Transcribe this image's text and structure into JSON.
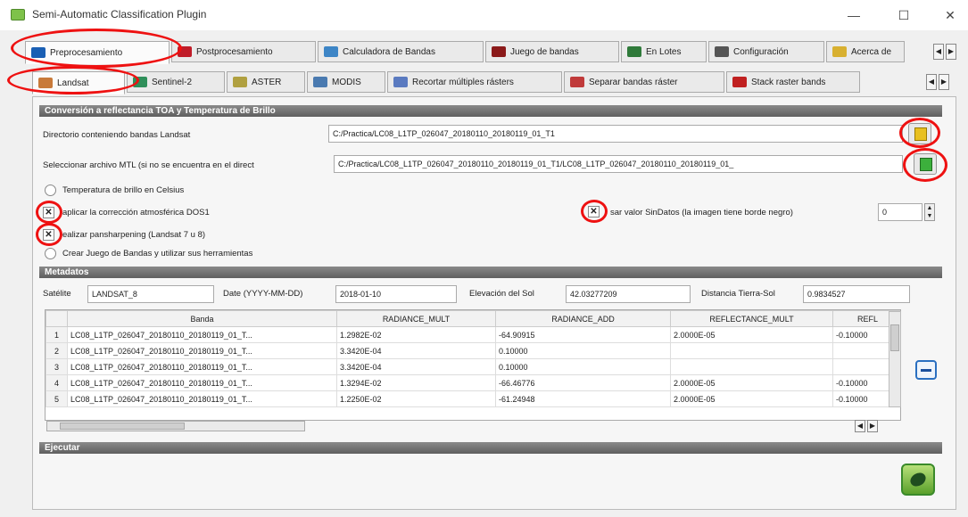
{
  "window": {
    "title": "Semi-Automatic Classification Plugin",
    "minimize": "—",
    "maximize": "☐",
    "close": "✕"
  },
  "main_tabs": [
    {
      "label": "Preprocesamiento",
      "icon": "arrow-in-icon",
      "color": "#1a5fb4"
    },
    {
      "label": "Postprocesamiento",
      "icon": "arrow-out-icon",
      "color": "#c01c28"
    },
    {
      "label": "Calculadora de Bandas",
      "icon": "calculator-icon",
      "color": "#3d85c6"
    },
    {
      "label": "Juego de bandas",
      "icon": "layers-icon",
      "color": "#8b1a1a"
    },
    {
      "label": "En Lotes",
      "icon": "batch-icon",
      "color": "#2f7a3a"
    },
    {
      "label": "Configuración",
      "icon": "tools-icon",
      "color": "#555555"
    },
    {
      "label": "Acerca de",
      "icon": "about-icon",
      "color": "#d8b030"
    }
  ],
  "sub_tabs": [
    {
      "label": "Landsat",
      "icon": "landsat-icon",
      "color": "#c87a3a"
    },
    {
      "label": "Sentinel-2",
      "icon": "sentinel-icon",
      "color": "#2f8f5a"
    },
    {
      "label": "ASTER",
      "icon": "aster-icon",
      "color": "#b0a040"
    },
    {
      "label": "MODIS",
      "icon": "modis-icon",
      "color": "#4a7ab0"
    },
    {
      "label": "Recortar múltiples rásters",
      "icon": "clip-icon",
      "color": "#5a7ac0"
    },
    {
      "label": "Separar bandas ráster",
      "icon": "split-icon",
      "color": "#c03a3a"
    },
    {
      "label": "Stack raster bands",
      "icon": "stack-icon",
      "color": "#c02020"
    }
  ],
  "conversion": {
    "header": "Conversión a reflectancia TOA y Temperatura de Brillo",
    "dir_label": "Directorio conteniendo bandas Landsat",
    "dir_value": "C:/Practica/LC08_L1TP_026047_20180110_20180119_01_T1",
    "mtl_label": "Seleccionar archivo MTL (si no se encuentra en el direct",
    "mtl_value": "C:/Practica/LC08_L1TP_026047_20180110_20180119_01_T1/LC08_L1TP_026047_20180110_20180119_01_",
    "celsius_label": "Temperatura de brillo en Celsius",
    "dos1_label": "aplicar la corrección atmosférica DOS1",
    "nodata_label": "sar valor SinDatos (la imagen tiene borde negro)",
    "nodata_value": "0",
    "pansharp_label": "ealizar pansharpening (Landsat 7 u 8)",
    "bandset_label": "Crear Juego de Bandas y utilizar sus herramientas",
    "checked_mark": "✕"
  },
  "metadata": {
    "header": "Metadatos",
    "satellite_label": "Satélite",
    "satellite_value": "LANDSAT_8",
    "date_label": "Date (YYYY-MM-DD)",
    "date_value": "2018-01-10",
    "sun_label": "Elevación del Sol",
    "sun_value": "42.03277209",
    "dist_label": "Distancia Tierra-Sol",
    "dist_value": "0.9834527"
  },
  "table": {
    "columns": [
      "Banda",
      "RADIANCE_MULT",
      "RADIANCE_ADD",
      "REFLECTANCE_MULT",
      "REFL"
    ],
    "rows": [
      {
        "n": "1",
        "banda": "LC08_L1TP_026047_20180110_20180119_01_T...",
        "rmult": "1.2982E-02",
        "radd": "-64.90915",
        "refmult": "2.0000E-05",
        "refl": "-0.10000"
      },
      {
        "n": "2",
        "banda": "LC08_L1TP_026047_20180110_20180119_01_T...",
        "rmult": "3.3420E-04",
        "radd": "0.10000",
        "refmult": "",
        "refl": ""
      },
      {
        "n": "3",
        "banda": "LC08_L1TP_026047_20180110_20180119_01_T...",
        "rmult": "3.3420E-04",
        "radd": "0.10000",
        "refmult": "",
        "refl": ""
      },
      {
        "n": "4",
        "banda": "LC08_L1TP_026047_20180110_20180119_01_T...",
        "rmult": "1.3294E-02",
        "radd": "-66.46776",
        "refmult": "2.0000E-05",
        "refl": "-0.10000"
      },
      {
        "n": "5",
        "banda": "LC08_L1TP_026047_20180110_20180119_01_T...",
        "rmult": "1.2250E-02",
        "radd": "-61.24948",
        "refmult": "2.0000E-05",
        "refl": "-0.10000"
      }
    ]
  },
  "execute": {
    "header": "Ejecutar"
  }
}
